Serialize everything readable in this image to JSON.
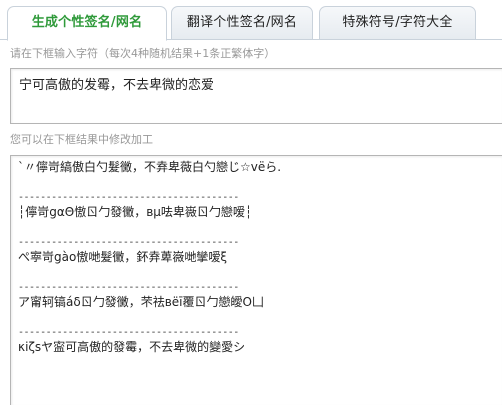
{
  "tabs": [
    {
      "label": "生成个性签名/网名",
      "active": true
    },
    {
      "label": "翻译个性签名/网名",
      "active": false
    },
    {
      "label": "特殊符号/字符大全",
      "active": false
    }
  ],
  "input_hint": "请在下框输入字符（每次4种随机结果+1条正繁体字）",
  "input_value": "宁可高傲的发霉，不去卑微的恋爱",
  "result_hint": "您可以在下框结果中修改加工",
  "results": {
    "line1": "`〃儜岢縞傲白勺髮黴，不弆卑薇白勺戀じ☆vёら.",
    "sep1": "----------------------------------------",
    "line2": "┆儜岢gαΘ慠ㄖ勹發黴，вμ呿卑嶶ㄖ勹戀嗳┆",
    "sep2": "----------------------------------------",
    "line3": "ぺ寕岢gào慠哋髮黴，鈈弆萆嶶哋攣嗳ξ",
    "sep3": "----------------------------------------",
    "line4": "ア甯轲镐áδㄖ勹發黴，芣祛вëī覆ㄖ勹戀皧Ο凵",
    "sep4": "----------------------------------------",
    "line5": "κiζsヤ寍可高傲的發霉，不去卑微的變愛シ"
  }
}
